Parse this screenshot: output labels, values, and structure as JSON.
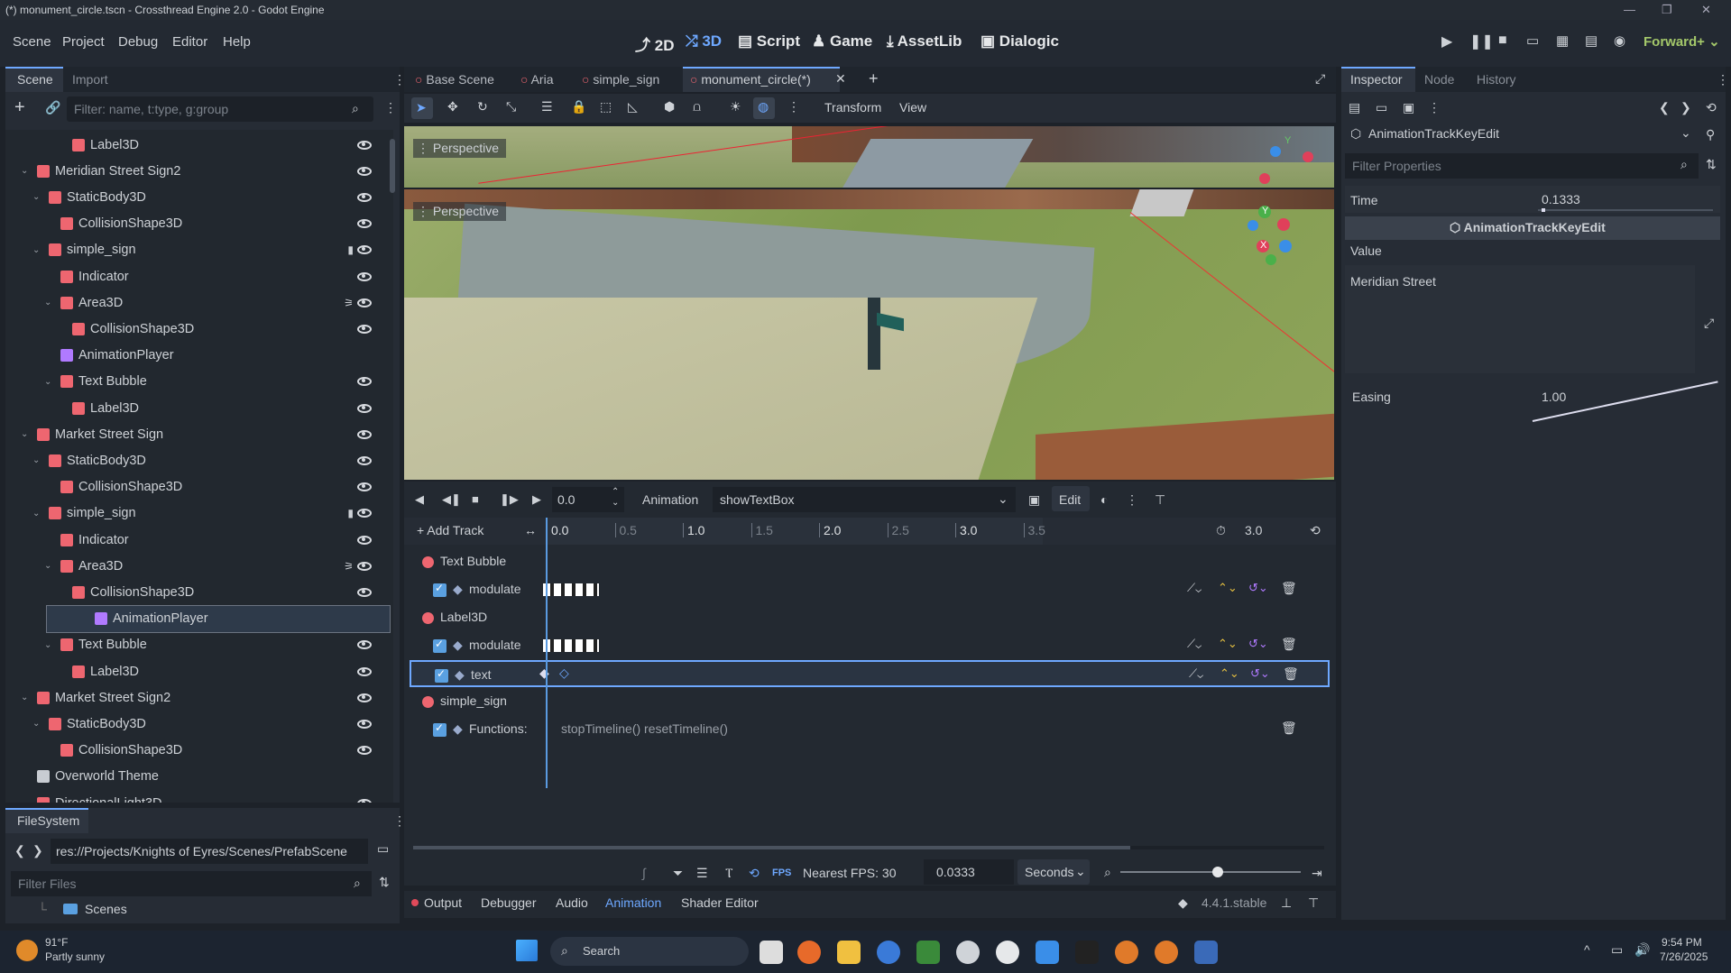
{
  "window": {
    "title": "(*) monument_circle.tscn - Crossthread Engine 2.0 - Godot Engine"
  },
  "menu": [
    "Scene",
    "Project",
    "Debug",
    "Editor",
    "Help"
  ],
  "workspaces": [
    "2D",
    "3D",
    "Script",
    "Game",
    "AssetLib",
    "Dialogic"
  ],
  "renderer": "Forward+",
  "scene_panel": {
    "tabs": [
      "Scene",
      "Import"
    ],
    "filter_placeholder": "Filter: name, t:type, g:group",
    "nodes": [
      {
        "name": "Label3D",
        "indent": 4,
        "color": "#ee6670",
        "eye": true
      },
      {
        "name": "Meridian Street Sign2",
        "indent": 1,
        "color": "#ee6670",
        "eye": true,
        "arrow": true
      },
      {
        "name": "StaticBody3D",
        "indent": 2,
        "color": "#ee6670",
        "eye": true,
        "arrow": true
      },
      {
        "name": "CollisionShape3D",
        "indent": 3,
        "color": "#ee6670",
        "eye": true
      },
      {
        "name": "simple_sign",
        "indent": 2,
        "color": "#ee6670",
        "eye": true,
        "arrow": true,
        "script": true
      },
      {
        "name": "Indicator",
        "indent": 3,
        "color": "#ee6670",
        "eye": true
      },
      {
        "name": "Area3D",
        "indent": 3,
        "color": "#ee6670",
        "eye": true,
        "arrow": true,
        "signal": true
      },
      {
        "name": "CollisionShape3D",
        "indent": 4,
        "color": "#ee6670",
        "eye": true
      },
      {
        "name": "AnimationPlayer",
        "indent": 3,
        "color": "#b07aff",
        "eye": false
      },
      {
        "name": "Text Bubble",
        "indent": 3,
        "color": "#ee6670",
        "eye": true,
        "arrow": true
      },
      {
        "name": "Label3D",
        "indent": 4,
        "color": "#ee6670",
        "eye": true
      },
      {
        "name": "Market Street Sign",
        "indent": 1,
        "color": "#ee6670",
        "eye": true,
        "arrow": true
      },
      {
        "name": "StaticBody3D",
        "indent": 2,
        "color": "#ee6670",
        "eye": true,
        "arrow": true
      },
      {
        "name": "CollisionShape3D",
        "indent": 3,
        "color": "#ee6670",
        "eye": true
      },
      {
        "name": "simple_sign",
        "indent": 2,
        "color": "#ee6670",
        "eye": true,
        "arrow": true,
        "script": true
      },
      {
        "name": "Indicator",
        "indent": 3,
        "color": "#ee6670",
        "eye": true
      },
      {
        "name": "Area3D",
        "indent": 3,
        "color": "#ee6670",
        "eye": true,
        "arrow": true,
        "signal": true
      },
      {
        "name": "CollisionShape3D",
        "indent": 4,
        "color": "#ee6670",
        "eye": true
      },
      {
        "name": "AnimationPlayer",
        "indent": 3,
        "color": "#b07aff",
        "eye": false,
        "selected": true
      },
      {
        "name": "Text Bubble",
        "indent": 3,
        "color": "#ee6670",
        "eye": true,
        "arrow": true
      },
      {
        "name": "Label3D",
        "indent": 4,
        "color": "#ee6670",
        "eye": true
      },
      {
        "name": "Market Street Sign2",
        "indent": 1,
        "color": "#ee6670",
        "eye": true,
        "arrow": true
      },
      {
        "name": "StaticBody3D",
        "indent": 2,
        "color": "#ee6670",
        "eye": true,
        "arrow": true
      },
      {
        "name": "CollisionShape3D",
        "indent": 3,
        "color": "#ee6670",
        "eye": true
      },
      {
        "name": "Overworld Theme",
        "indent": 1,
        "color": "#c8ccd2",
        "eye": false
      },
      {
        "name": "DirectionalLight3D",
        "indent": 1,
        "color": "#ee6670",
        "eye": true
      }
    ]
  },
  "filesystem": {
    "tab": "FileSystem",
    "path": "res://Projects/Knights of Eyres/Scenes/PrefabScene",
    "filter_placeholder": "Filter Files",
    "item": "Scenes"
  },
  "scene_tabs": [
    "Base Scene",
    "Aria",
    "simple_sign",
    "monument_circle(*)"
  ],
  "viewport": {
    "toolbar": [
      "Transform",
      "View"
    ],
    "label_top": "Perspective",
    "label_main": "Perspective"
  },
  "animation": {
    "time": "0.0",
    "label": "Animation",
    "name": "showTextBox",
    "edit": "Edit",
    "add_track": "Add Track",
    "ruler": [
      "0.0",
      "0.5",
      "1.0",
      "1.5",
      "2.0",
      "2.5",
      "3.0",
      "3.5"
    ],
    "length": "3.0",
    "tracks": [
      {
        "type": "node",
        "name": "Text Bubble"
      },
      {
        "type": "prop",
        "name": "modulate"
      },
      {
        "type": "node",
        "name": "Label3D"
      },
      {
        "type": "prop",
        "name": "modulate"
      },
      {
        "type": "prop",
        "name": "text",
        "selected": true
      },
      {
        "type": "node",
        "name": "simple_sign"
      },
      {
        "type": "prop",
        "name": "Functions:",
        "keys": "stopTimeline()  resetTimeline()"
      }
    ],
    "fps_label": "Nearest FPS: 30",
    "step": "0.0333",
    "unit": "Seconds"
  },
  "bottom_tabs": [
    "Output",
    "Debugger",
    "Audio",
    "Animation",
    "Shader Editor"
  ],
  "version": "4.4.1.stable",
  "inspector": {
    "tabs": [
      "Inspector",
      "Node",
      "History"
    ],
    "object": "AnimationTrackKeyEdit",
    "filter_placeholder": "Filter Properties",
    "time_label": "Time",
    "time_value": "0.1333",
    "section": "AnimationTrackKeyEdit",
    "value_label": "Value",
    "value_text": "Meridian Street",
    "easing_label": "Easing",
    "easing_value": "1.00"
  },
  "taskbar": {
    "weather_temp": "91°F",
    "weather_desc": "Partly sunny",
    "search": "Search",
    "time": "9:54 PM",
    "date": "7/26/2025"
  }
}
